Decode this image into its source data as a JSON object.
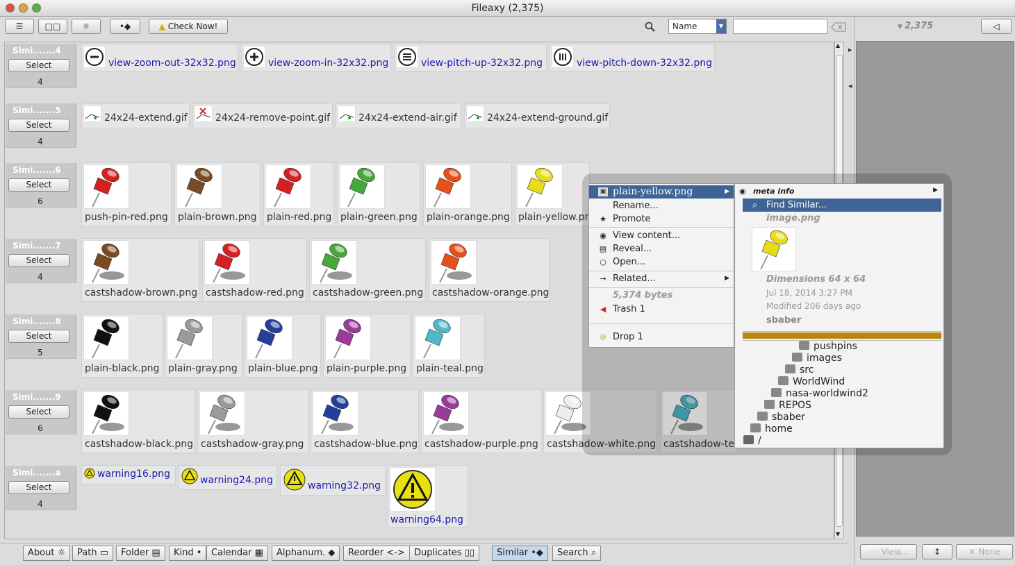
{
  "window": {
    "title": "Fileaxy  (2,375)"
  },
  "toolbar": {
    "menu_icon": "☰",
    "view_icon": "□□",
    "gear_icon": "☼",
    "diamond_icon": "•◆",
    "check_now": "Check Now!",
    "sort_selected": "Name",
    "search_value": ""
  },
  "right_pane": {
    "count": "2,375",
    "view_label": "View...",
    "none_label": "None"
  },
  "groups": [
    {
      "title": "Simi.......4",
      "select": "Select",
      "count": "4"
    },
    {
      "title": "Simi.......5",
      "select": "Select",
      "count": "4"
    },
    {
      "title": "Simi.......6",
      "select": "Select",
      "count": "6"
    },
    {
      "title": "Simi.......7",
      "select": "Select",
      "count": "4"
    },
    {
      "title": "Simi.......8",
      "select": "Select",
      "count": "5"
    },
    {
      "title": "Simi.......9",
      "select": "Select",
      "count": "6"
    },
    {
      "title": "Simi.......a",
      "select": "Select",
      "count": "4"
    }
  ],
  "files": {
    "row1": [
      "view-zoom-out-32x32.png",
      "view-zoom-in-32x32.png",
      "view-pitch-up-32x32.png",
      "view-pitch-down-32x32.png"
    ],
    "row2": [
      "24x24-extend.gif",
      "24x24-remove-point.gif",
      "24x24-extend-air.gif",
      "24x24-extend-ground.gif"
    ],
    "row3": [
      "push-pin-red.png",
      "plain-brown.png",
      "plain-red.png",
      "plain-green.png",
      "plain-orange.png",
      "plain-yellow.pn"
    ],
    "row4": [
      "castshadow-brown.png",
      "castshadow-red.png",
      "castshadow-green.png",
      "castshadow-orange.png"
    ],
    "row5": [
      "plain-black.png",
      "plain-gray.png",
      "plain-blue.png",
      "plain-purple.png",
      "plain-teal.png"
    ],
    "row6": [
      "castshadow-black.png",
      "castshadow-gray.png",
      "castshadow-blue.png",
      "castshadow-purple.png",
      "castshadow-white.png",
      "castshadow-tea"
    ],
    "row7": [
      "warning16.png",
      "warning24.png",
      "warning32.png",
      "warning64.png"
    ]
  },
  "pin_colors": {
    "row3": [
      "#d42020",
      "#7a4a22",
      "#d42020",
      "#45a83a",
      "#e8501a",
      "#e8dc18"
    ],
    "row4": [
      "#7a4a22",
      "#d42020",
      "#45a83a",
      "#e8501a"
    ],
    "row5": [
      "#111111",
      "#9a9a9a",
      "#233f9a",
      "#9a3a9a",
      "#4fb8c8"
    ],
    "row6": [
      "#111111",
      "#9a9a9a",
      "#233f9a",
      "#9a3a9a",
      "#eeeeee",
      "#4fb8c8"
    ]
  },
  "context_menu": {
    "header": "plain-yellow.png",
    "items": [
      "Rename...",
      "Promote",
      "View content...",
      "Reveal...",
      "Open...",
      "Related...",
      "5,374 bytes",
      "Trash 1",
      "Drop 1"
    ]
  },
  "submenu": {
    "meta_info": "meta info",
    "find_similar": "Find Similar...",
    "kind": "image.png",
    "dimensions": "Dimensions 64 x 64",
    "date": "Jul 18, 2014 3:27 PM",
    "modified": "Modified 206 days ago",
    "owner": "sbaber",
    "path": [
      "pushpins",
      "images",
      "src",
      "WorldWind",
      "nasa-worldwind2",
      "REPOS",
      "sbaber",
      "home",
      "/"
    ]
  },
  "bottom_tabs": [
    "About",
    "Path",
    "Folder",
    "Kind",
    "Calendar",
    "Alphanum.",
    "Reorder",
    "Duplicates",
    "Similar",
    "Search"
  ],
  "colors": {
    "accent": "#3d6494",
    "selected_tab": "#c6d8ee",
    "link": "#1b1bb0",
    "drop_bar": "#b8860b"
  }
}
